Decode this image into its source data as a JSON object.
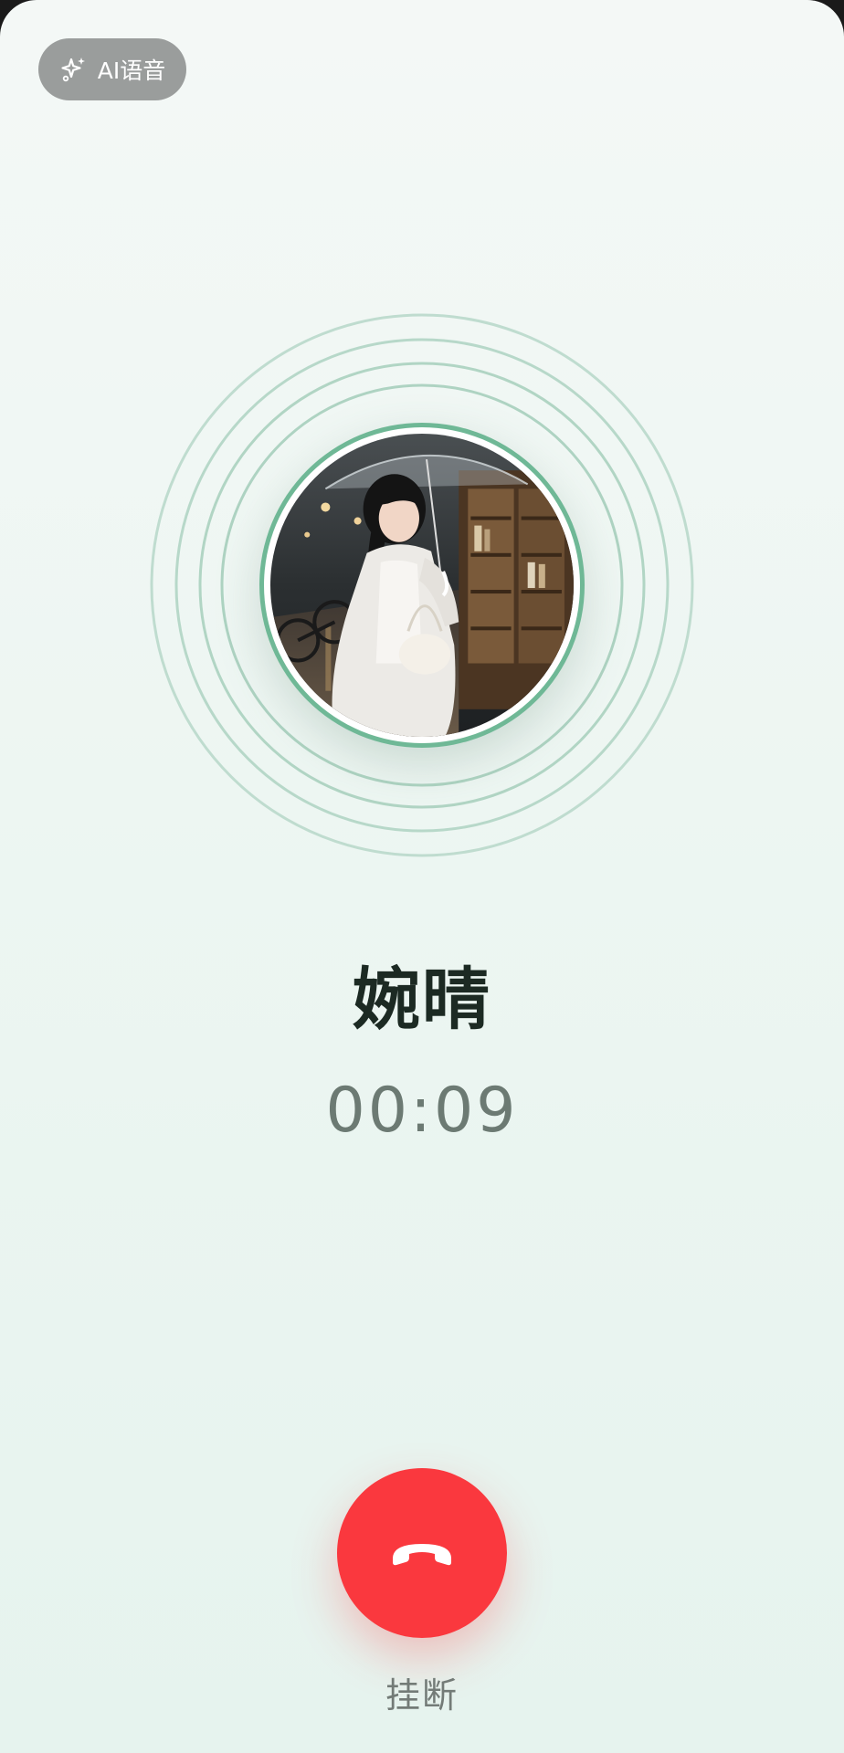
{
  "header": {
    "ai_badge_label": "AI语音",
    "ai_badge_icon": "sparkle-icon"
  },
  "caller": {
    "name": "婉晴",
    "avatar_icon": "avatar"
  },
  "call": {
    "elapsed": "00:09"
  },
  "controls": {
    "hangup_label": "挂断",
    "hangup_icon": "phone-hangup-icon"
  },
  "colors": {
    "accent_ring": "#6fb896",
    "hangup_red": "#fa383e",
    "badge_gray": "#9a9d9c"
  }
}
